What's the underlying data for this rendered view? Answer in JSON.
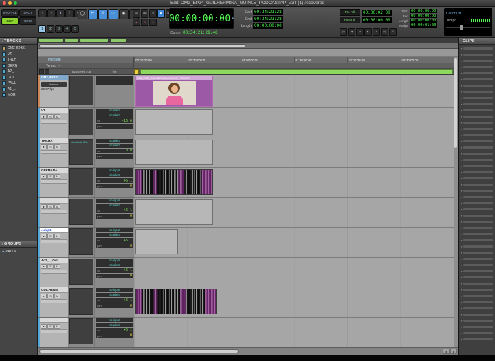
{
  "window": {
    "title": "Edit: OM2_EP24_GUILHERMINA_GUINLE_PODCASTAP_V3T (1).recovered"
  },
  "icons": {
    "clip_arrow": "▸",
    "panel_arrow": "◂",
    "menu": "≡",
    "dropdown": "▾",
    "plus": "+",
    "zoom_buttons": [
      "«",
      "»",
      "▮",
      "▯",
      "◆"
    ],
    "tools": [
      "◯",
      "⊢",
      "Ⅰ",
      "☞",
      "◉",
      "✎"
    ],
    "transport": [
      "|◀",
      "◀◀",
      "■",
      "▶",
      "▶▶",
      "▶|"
    ],
    "transport2": [
      "●",
      "↻",
      "Δ"
    ],
    "mini_transport": [
      "|◀",
      "◀",
      "■",
      "▶",
      "●",
      "▶|",
      "↻"
    ],
    "group_diamond": "◆"
  },
  "toolbar": {
    "modes": {
      "shuffle": "SHUFFLE",
      "spot": "SPOT",
      "slip": "SLIP",
      "grid": "GRID"
    },
    "zoom_presets": [
      "1",
      "2",
      "3",
      "4",
      "5"
    ],
    "main_counter": "00:00:00:00",
    "cursor_label": "Cursor",
    "cursor_value": "00:34:21:28.46",
    "selection": {
      "start_label": "Start",
      "start": "00:34:21:28",
      "end_label": "End",
      "end": "00:34:21:28",
      "length_label": "Length",
      "length": "00:00:00:00"
    },
    "rolls": {
      "pre_label": "Pre-roll",
      "pre": "00:00:02:00",
      "post_label": "Post-roll",
      "post": "00:00:00:00"
    },
    "range2": {
      "start_label": "Start",
      "start": "00:00:00:00",
      "end_label": "End",
      "end": "00:00:00:00",
      "length_label": "Length",
      "length": "00:00:00:00",
      "nudge_label": "Nudge",
      "nudge": "00:00:01:00"
    },
    "count_off_label": "Count Off",
    "tempo_label": "Tempo"
  },
  "tracks_panel": {
    "header": "TRACKS",
    "items": [
      {
        "name": "OM2 E2431"
      },
      {
        "name": "VT."
      },
      {
        "name": "TRLH"
      },
      {
        "name": "GERN"
      },
      {
        "name": "A2_L"
      },
      {
        "name": "GUIL"
      },
      {
        "name": "PAUL"
      },
      {
        "name": "A1_L"
      },
      {
        "name": "MOR"
      }
    ]
  },
  "groups_panel": {
    "header": "GROUPS",
    "items": [
      {
        "name": "<ALL>"
      }
    ]
  },
  "clips_panel": {
    "header": "CLIPS",
    "row_count": 48
  },
  "rulers": {
    "timebase": "Timecode",
    "tempo": "Tempo",
    "ticks": [
      "00:00:00:00",
      "00:30:00:00",
      "01:00:00:00",
      "01:30:00:00",
      "02:00:00:00",
      "02:30:00:00"
    ]
  },
  "columns": {
    "inserts": "INSERTS A-E",
    "io": "I/O"
  },
  "labels": {
    "vol": "vol",
    "pan": "pan",
    "rec": "●",
    "solo": "S",
    "mute": "M"
  },
  "edit_tracks": [
    {
      "name": "OM2_E2431",
      "sub1": "frames",
      "sub2": "29.97 fps",
      "insert": "",
      "io1": "",
      "io2": "",
      "vol": "",
      "pan": "",
      "clip": "OM2_EP24_GUILHERMINA_GUINLE_PODCAST"
    },
    {
      "name": "VT.",
      "insert": "",
      "io1": "scarlett",
      "io2": "scarlett",
      "vol": "-16.6",
      "pan": ""
    },
    {
      "name": "TRILHA",
      "insert": "blackhole 2ch",
      "io1": "scarlett",
      "io2": "scarlett",
      "vol": "0.0",
      "pan": ""
    },
    {
      "name": "GERMANA",
      "insert": "",
      "io1": "no input",
      "io2": "scarlett",
      "vol": "+6.1",
      "pan": "0"
    },
    {
      "name": "",
      "insert": "",
      "io1": "no input",
      "io2": "scarlett",
      "vol": "+6.1",
      "pan": "0"
    },
    {
      "name": "...dup1",
      "insert": "",
      "io1": "no input",
      "io2": "scarlett",
      "vol": "+6.1",
      "pan": "0"
    },
    {
      "name": "Ad2_L_Ovr",
      "insert": "",
      "io1": "no input",
      "io2": "scarlett",
      "vol": "+6.1",
      "pan": "0"
    },
    {
      "name": "GUILHERMI",
      "insert": "",
      "io1": "no input",
      "io2": "scarlett",
      "vol": "+6.1",
      "pan": "0"
    },
    {
      "name": "",
      "insert": "",
      "io1": "no input",
      "io2": "scarlett",
      "vol": "+6.1",
      "pan": "0"
    }
  ]
}
